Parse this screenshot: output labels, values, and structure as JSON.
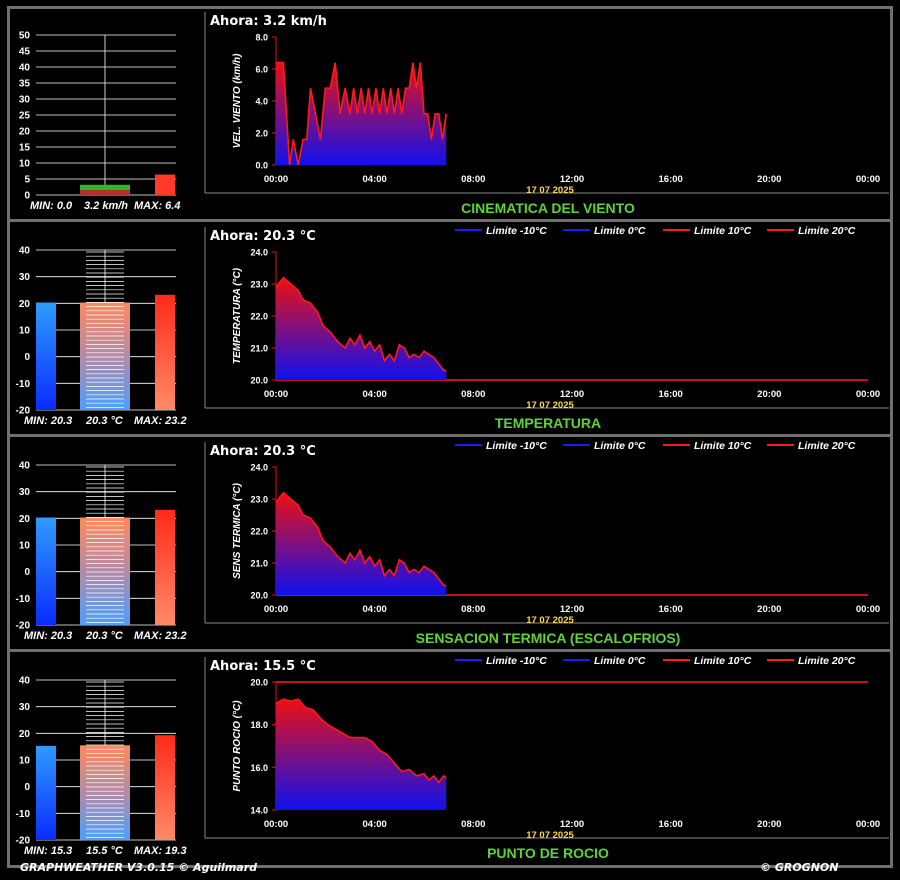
{
  "footer": {
    "left": "GRAPHWEATHER V3.0.15 © Aguilmard",
    "right": "© GROGNON"
  },
  "colors": {
    "title": "#5fd33a",
    "date": "#ffd84a",
    "series_fill_top": "#ee1010",
    "series_fill_bottom": "#1010ee",
    "limit_blue": "#1a1aff",
    "limit_red": "#ff1a1a"
  },
  "chart_data": [
    {
      "type": "area",
      "title": "CINEMATICA DEL VIENTO",
      "now_label": "Ahora: 3.2 km/h",
      "ylabel": "VEL. VIENTO (km/h)",
      "ylim": [
        0,
        8
      ],
      "yticks": [
        "0.0",
        "2.0",
        "4.0",
        "6.0",
        "8.0"
      ],
      "xticks": [
        "00:00",
        "04:00",
        "08:00",
        "12:00",
        "16:00",
        "20:00",
        "00:00"
      ],
      "date": "17 07 2025",
      "legend": [],
      "x": [
        0,
        0.15,
        0.3,
        0.55,
        0.7,
        0.9,
        1.1,
        1.25,
        1.4,
        1.6,
        1.8,
        2.0,
        2.2,
        2.4,
        2.6,
        2.8,
        3.0,
        3.15,
        3.3,
        3.45,
        3.6,
        3.75,
        3.9,
        4.05,
        4.2,
        4.35,
        4.5,
        4.65,
        4.8,
        4.95,
        5.1,
        5.25,
        5.4,
        5.55,
        5.7,
        5.85,
        6.0,
        6.15,
        6.3,
        6.45,
        6.6,
        6.75,
        6.9
      ],
      "values": [
        6.4,
        6.4,
        6.4,
        0.0,
        1.6,
        0.0,
        1.6,
        1.6,
        4.8,
        3.2,
        1.6,
        4.8,
        4.8,
        6.4,
        3.2,
        4.8,
        3.2,
        4.8,
        3.2,
        4.8,
        3.2,
        4.8,
        3.2,
        4.8,
        3.2,
        4.8,
        3.2,
        4.8,
        3.2,
        4.8,
        3.2,
        4.8,
        4.8,
        6.4,
        4.8,
        6.4,
        3.2,
        3.2,
        1.6,
        3.2,
        3.2,
        1.6,
        3.2
      ],
      "gauge": {
        "type": "wind",
        "min": "MIN: 0.0",
        "now": "3.2 km/h",
        "max": "MAX: 6.4",
        "ylim": [
          0,
          50
        ],
        "yticks": [
          "0",
          "5",
          "10",
          "15",
          "20",
          "25",
          "30",
          "35",
          "40",
          "45",
          "50"
        ],
        "min_value": 0.0,
        "now_value": 3.2,
        "max_value": 6.4
      }
    },
    {
      "type": "area",
      "title": "TEMPERATURA",
      "now_label": "Ahora: 20.3 °C",
      "ylabel": "TEMPERATURA (°C)",
      "ylim": [
        20,
        24
      ],
      "yticks": [
        "20.0",
        "21.0",
        "22.0",
        "23.0",
        "24.0"
      ],
      "xticks": [
        "00:00",
        "04:00",
        "08:00",
        "12:00",
        "16:00",
        "20:00",
        "00:00"
      ],
      "date": "17 07 2025",
      "legend": [
        "Limite -10°C",
        "Limite 0°C",
        "Limite 10°C",
        "Limite 20°C"
      ],
      "limit_line": 20,
      "x": [
        0,
        0.3,
        0.6,
        0.9,
        1.1,
        1.4,
        1.7,
        1.9,
        2.2,
        2.5,
        2.8,
        3.0,
        3.2,
        3.4,
        3.6,
        3.8,
        4.0,
        4.2,
        4.4,
        4.6,
        4.8,
        5.0,
        5.2,
        5.4,
        5.6,
        5.8,
        6.0,
        6.2,
        6.4,
        6.6,
        6.8,
        6.9
      ],
      "values": [
        22.9,
        23.2,
        23.0,
        22.8,
        22.5,
        22.4,
        22.1,
        21.7,
        21.5,
        21.2,
        21.0,
        21.3,
        21.1,
        21.4,
        21.0,
        21.2,
        20.9,
        21.1,
        20.6,
        20.8,
        20.6,
        21.1,
        21.0,
        20.7,
        20.8,
        20.7,
        20.9,
        20.8,
        20.7,
        20.5,
        20.3,
        20.3
      ],
      "gauge": {
        "type": "temp",
        "min": "MIN: 20.3",
        "now": "20.3 °C",
        "max": "MAX: 23.2",
        "ylim": [
          -20,
          40
        ],
        "yticks": [
          "-20",
          "-10",
          "0",
          "10",
          "20",
          "30",
          "40"
        ],
        "min_value": 20.3,
        "now_value": 20.3,
        "max_value": 23.2
      }
    },
    {
      "type": "area",
      "title": "SENSACION TERMICA (ESCALOFRIOS)",
      "now_label": "Ahora: 20.3 °C",
      "ylabel": "SENS TERMICA (°C)",
      "ylim": [
        20,
        24
      ],
      "yticks": [
        "20.0",
        "21.0",
        "22.0",
        "23.0",
        "24.0"
      ],
      "xticks": [
        "00:00",
        "04:00",
        "08:00",
        "12:00",
        "16:00",
        "20:00",
        "00:00"
      ],
      "date": "17 07 2025",
      "legend": [
        "Limite -10°C",
        "Limite 0°C",
        "Limite 10°C",
        "Limite 20°C"
      ],
      "limit_line": 20,
      "x": [
        0,
        0.3,
        0.6,
        0.9,
        1.1,
        1.4,
        1.7,
        1.9,
        2.2,
        2.5,
        2.8,
        3.0,
        3.2,
        3.4,
        3.6,
        3.8,
        4.0,
        4.2,
        4.4,
        4.6,
        4.8,
        5.0,
        5.2,
        5.4,
        5.6,
        5.8,
        6.0,
        6.2,
        6.4,
        6.6,
        6.8,
        6.9
      ],
      "values": [
        22.9,
        23.2,
        23.0,
        22.8,
        22.5,
        22.4,
        22.1,
        21.7,
        21.5,
        21.2,
        21.0,
        21.3,
        21.1,
        21.4,
        21.0,
        21.2,
        20.9,
        21.1,
        20.6,
        20.8,
        20.6,
        21.1,
        21.0,
        20.7,
        20.8,
        20.7,
        20.9,
        20.8,
        20.7,
        20.5,
        20.3,
        20.3
      ],
      "gauge": {
        "type": "temp",
        "min": "MIN: 20.3",
        "now": "20.3 °C",
        "max": "MAX: 23.2",
        "ylim": [
          -20,
          40
        ],
        "yticks": [
          "-20",
          "-10",
          "0",
          "10",
          "20",
          "30",
          "40"
        ],
        "min_value": 20.3,
        "now_value": 20.3,
        "max_value": 23.2
      }
    },
    {
      "type": "area",
      "title": "PUNTO DE ROCIO",
      "now_label": "Ahora: 15.5 °C",
      "ylabel": "PUNTO ROCIO (°C)",
      "ylim": [
        14,
        20
      ],
      "yticks": [
        "14.0",
        "16.0",
        "18.0",
        "20.0"
      ],
      "xticks": [
        "00:00",
        "04:00",
        "08:00",
        "12:00",
        "16:00",
        "20:00",
        "00:00"
      ],
      "date": "17 07 2025",
      "legend": [
        "Limite -10°C",
        "Limite 0°C",
        "Limite 10°C",
        "Limite 20°C"
      ],
      "limit_line": 20,
      "x": [
        0,
        0.3,
        0.6,
        0.9,
        1.2,
        1.5,
        1.8,
        2.1,
        2.4,
        2.7,
        3.0,
        3.3,
        3.6,
        3.9,
        4.2,
        4.5,
        4.8,
        5.1,
        5.4,
        5.7,
        6.0,
        6.2,
        6.4,
        6.6,
        6.8,
        6.9
      ],
      "values": [
        19.0,
        19.2,
        19.1,
        19.2,
        18.8,
        18.7,
        18.3,
        18.0,
        17.8,
        17.6,
        17.4,
        17.4,
        17.4,
        17.2,
        16.8,
        16.6,
        16.2,
        15.8,
        15.9,
        15.6,
        15.7,
        15.4,
        15.6,
        15.3,
        15.6,
        15.5
      ],
      "gauge": {
        "type": "temp",
        "min": "MIN: 15.3",
        "now": "15.5 °C",
        "max": "MAX: 19.3",
        "ylim": [
          -20,
          40
        ],
        "yticks": [
          "-20",
          "-10",
          "0",
          "10",
          "20",
          "30",
          "40"
        ],
        "min_value": 15.3,
        "now_value": 15.5,
        "max_value": 19.3
      }
    }
  ]
}
